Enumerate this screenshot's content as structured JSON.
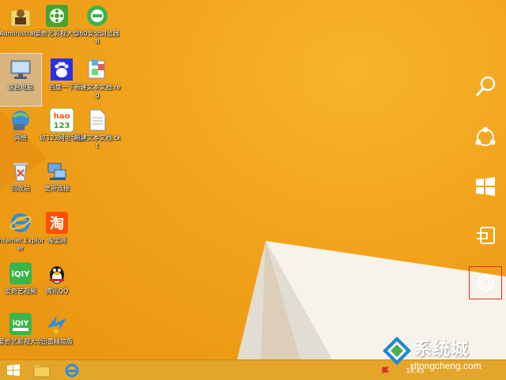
{
  "desktop": {
    "icons": [
      {
        "label": "Administrat...",
        "icon": "user-folder-icon"
      },
      {
        "label": "爱奇艺影视大全",
        "icon": "film-icon"
      },
      {
        "label": "360安全浏览器8",
        "icon": "browser-360-icon"
      },
      {
        "label": "这台电脑",
        "icon": "computer-icon"
      },
      {
        "label": "百度一下",
        "icon": "baidu-paw-icon"
      },
      {
        "label": "新建文本文档.reg",
        "icon": "reg-file-icon"
      },
      {
        "label": "网络",
        "icon": "network-icon"
      },
      {
        "label": "好123网址导航",
        "icon": "hao123-icon"
      },
      {
        "label": "新建文本文档.txt",
        "icon": "text-file-icon"
      },
      {
        "label": "回收站",
        "icon": "recycle-bin-icon"
      },
      {
        "label": "宽带连接",
        "icon": "broadband-icon"
      },
      {
        "label": "Internet Explorer",
        "icon": "ie-icon"
      },
      {
        "label": "淘宝网",
        "icon": "taobao-icon"
      },
      {
        "label": "爱奇艺视频",
        "icon": "iqiyi-icon"
      },
      {
        "label": "腾讯QQ",
        "icon": "qq-penguin-icon"
      },
      {
        "label": "爱奇艺影视大全",
        "icon": "iqiyi-dq-icon"
      },
      {
        "label": "迅雷精简版",
        "icon": "xunlei-bird-icon"
      }
    ]
  },
  "charms": [
    {
      "name": "search",
      "icon": "search-icon"
    },
    {
      "name": "share",
      "icon": "share-icon"
    },
    {
      "name": "start",
      "icon": "windows-logo-icon"
    },
    {
      "name": "devices",
      "icon": "devices-icon"
    },
    {
      "name": "settings",
      "icon": "gear-icon"
    }
  ],
  "icon_texts": {
    "hao": "hao",
    "hao_num": "123",
    "iqiyi": "iQIY",
    "iqiyi_dq": "iQIY",
    "taobao": "淘"
  },
  "taskbar": {
    "time": "14:45"
  },
  "watermark": {
    "title": "系统城",
    "url": "xitongcheng.com"
  },
  "colors": {
    "accent": "#f2a21b",
    "highlight": "#d0322a"
  }
}
